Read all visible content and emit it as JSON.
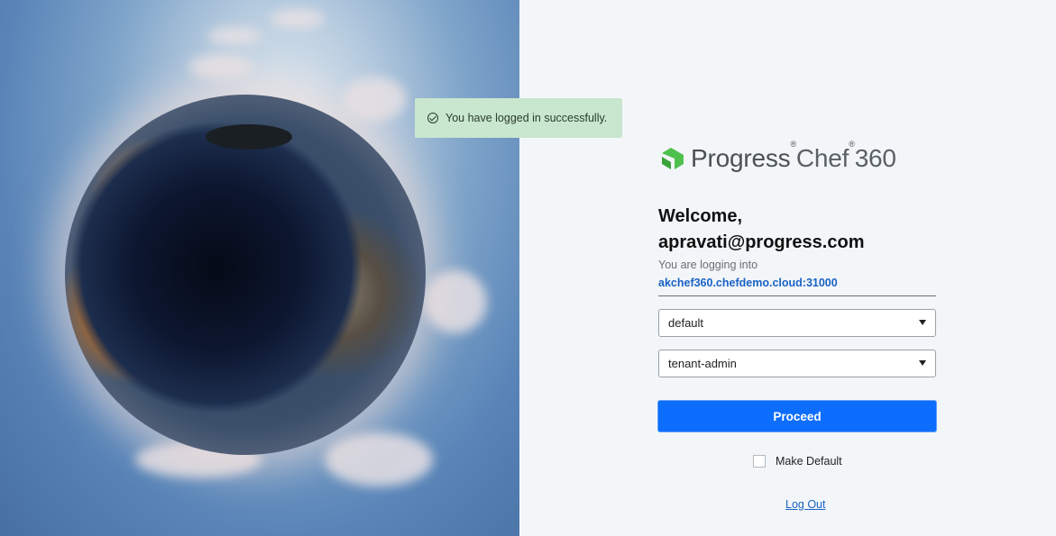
{
  "toast": {
    "message": "You have logged in successfully.",
    "icon": "check-circle-icon",
    "color": "#c9e6cf"
  },
  "brand": {
    "name": "Progress",
    "product": "Chef",
    "version": "360",
    "mark": "progress-logo-icon",
    "color": "#4fc04e"
  },
  "welcome": {
    "line1": "Welcome,",
    "line2": "apravati@progress.com"
  },
  "login_info": {
    "label": "You are logging into",
    "host": "akchef360.chefdemo.cloud:31000"
  },
  "org_select": {
    "value": "default"
  },
  "role_select": {
    "value": "tenant-admin"
  },
  "proceed_button": {
    "label": "Proceed",
    "color": "#0d6efd"
  },
  "make_default": {
    "label": "Make Default",
    "checked": false
  },
  "logout": {
    "label": "Log Out"
  }
}
